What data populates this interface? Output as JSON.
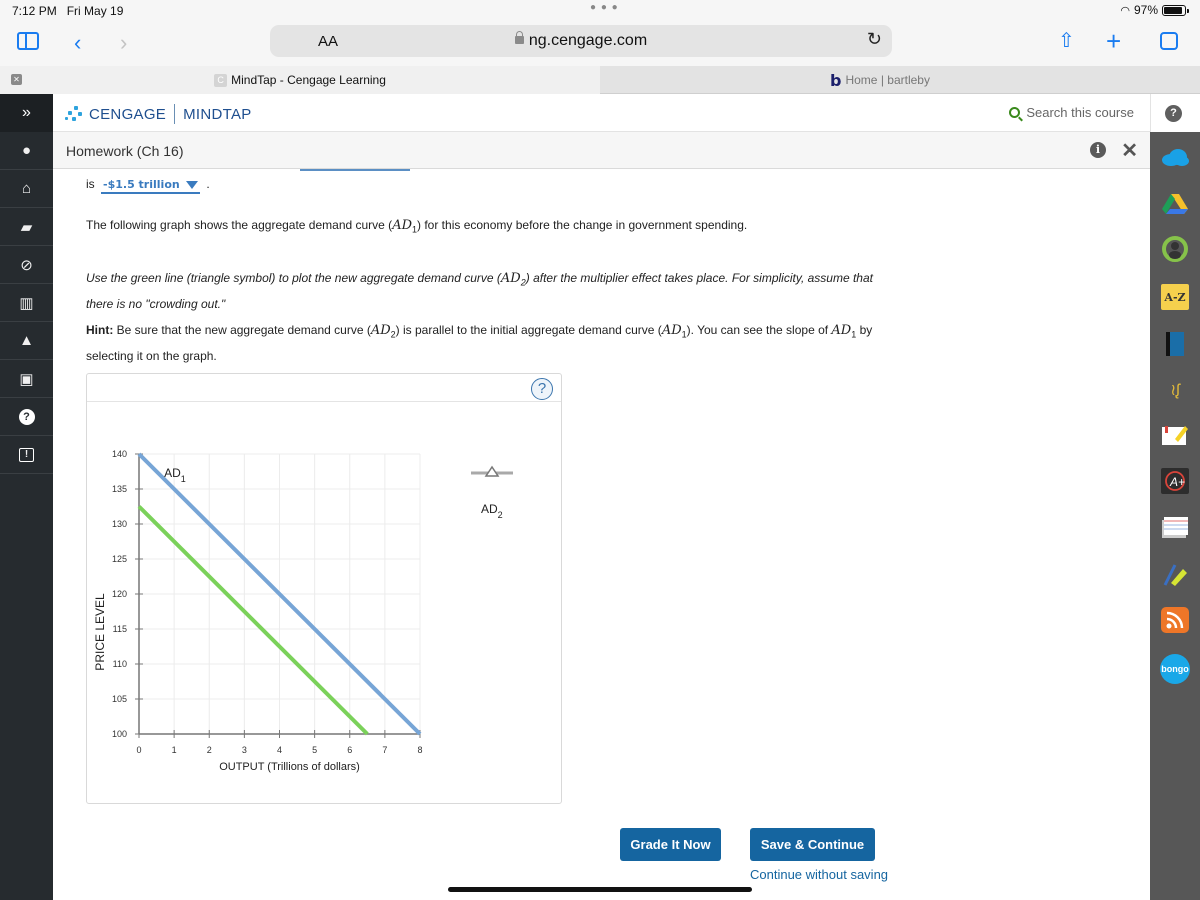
{
  "status_bar": {
    "time": "7:12 PM",
    "date": "Fri May 19",
    "battery": "97%"
  },
  "browser": {
    "text_size_label": "AA",
    "url": "ng.cengage.com",
    "tabs": [
      {
        "label": "MindTap - Cengage Learning",
        "favicon": "C",
        "active": true
      },
      {
        "label": "Home | bartleby",
        "favicon": "b",
        "active": false
      }
    ]
  },
  "left_nav": {
    "items": [
      {
        "name": "expand",
        "icon": "»"
      },
      {
        "name": "profile",
        "icon": "person-icon"
      },
      {
        "name": "home",
        "icon": "home-icon"
      },
      {
        "name": "book",
        "icon": "book-icon"
      },
      {
        "name": "compass",
        "icon": "compass-icon"
      },
      {
        "name": "reader",
        "icon": "open-book-icon"
      },
      {
        "name": "grades",
        "icon": "graduation-cap-icon"
      },
      {
        "name": "career",
        "icon": "briefcase-icon"
      },
      {
        "name": "help",
        "icon": "question-icon"
      },
      {
        "name": "feedback",
        "icon": "feedback-icon"
      }
    ]
  },
  "header": {
    "brand": "CENGAGE",
    "product": "MINDTAP",
    "search_placeholder": "Search this course"
  },
  "subheader": {
    "title": "Homework (Ch 16)"
  },
  "right_rail": {
    "apps": [
      "onedrive",
      "google-drive",
      "progress",
      "glossary A-Z",
      "ebook",
      "readspeaker",
      "notes",
      "aplia",
      "flashcards",
      "highlighter",
      "rss",
      "bongo"
    ]
  },
  "question": {
    "answer_prefix": "is",
    "answer_value": "-$1.5 trillion",
    "answer_suffix": ".",
    "para1_a": "The following graph shows the aggregate demand curve (",
    "para1_math": "AD",
    "para1_sub": "1",
    "para1_b": ") for this economy before the change in government spending.",
    "para2_a": "Use the green line (triangle symbol) to plot the new aggregate demand curve (",
    "para2_math": "AD",
    "para2_sub": "2",
    "para2_b": ") after the multiplier effect takes place. For simplicity, assume that there is no \"crowding out.\"",
    "hint_label": "Hint:",
    "hint_a": " Be sure that the new aggregate demand curve (",
    "hint_m1": "AD",
    "hint_s1": "2",
    "hint_b": ") is parallel to the initial aggregate demand curve (",
    "hint_m2": "AD",
    "hint_s2": "1",
    "hint_c": "). You can see the slope of ",
    "hint_m3": "AD",
    "hint_s3": "1",
    "hint_d": " by selecting it on the graph."
  },
  "graph_help": "?",
  "chart_data": {
    "type": "line",
    "xlabel": "OUTPUT (Trillions of dollars)",
    "ylabel": "PRICE LEVEL",
    "xlim": [
      0,
      8
    ],
    "ylim": [
      100,
      140
    ],
    "xticks": [
      0,
      1,
      2,
      3,
      4,
      5,
      6,
      7,
      8
    ],
    "yticks": [
      100,
      105,
      110,
      115,
      120,
      125,
      130,
      135,
      140
    ],
    "grid": true,
    "series": [
      {
        "name": "AD",
        "sub": "1",
        "color": "#77a5d6",
        "points": [
          [
            0,
            140
          ],
          [
            8,
            100
          ]
        ],
        "label_at": [
          1.0,
          137
        ]
      },
      {
        "name": "AD",
        "sub": "2",
        "color": "#7bd15a",
        "points": [
          [
            0,
            132.5
          ],
          [
            6.5,
            100
          ]
        ]
      }
    ],
    "palette_tool": {
      "name": "AD",
      "sub": "2",
      "symbol": "triangle",
      "color": "#a9a9a9"
    }
  },
  "buttons": {
    "grade": "Grade It Now",
    "save": "Save & Continue",
    "continue_link": "Continue without saving"
  }
}
